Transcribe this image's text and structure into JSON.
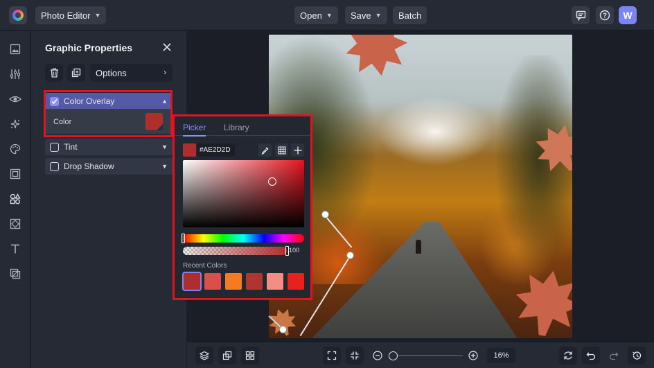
{
  "app": {
    "name": "Photo Editor",
    "user_initial": "W"
  },
  "topbar": {
    "open_label": "Open",
    "save_label": "Save",
    "batch_label": "Batch"
  },
  "panel": {
    "title": "Graphic Properties",
    "options_label": "Options",
    "sections": [
      {
        "label": "Color Overlay",
        "checked": true,
        "expanded": true
      },
      {
        "label": "Tint",
        "checked": false,
        "expanded": false
      },
      {
        "label": "Drop Shadow",
        "checked": false,
        "expanded": false
      }
    ],
    "color_label": "Color",
    "color_value": "#AE2D2D"
  },
  "picker": {
    "tabs": [
      "Picker",
      "Library"
    ],
    "active_tab": "Picker",
    "hex": "#AE2D2D",
    "opacity": "100",
    "recent_label": "Recent Colors",
    "recent_colors": [
      "#AE2D2D",
      "#DA4F49",
      "#F47B20",
      "#B0342F",
      "#F48D86",
      "#E8211D"
    ]
  },
  "zoom": {
    "value": "16%"
  },
  "colors": {
    "accent": "#8A8FF5",
    "highlight": "#E0141E"
  }
}
